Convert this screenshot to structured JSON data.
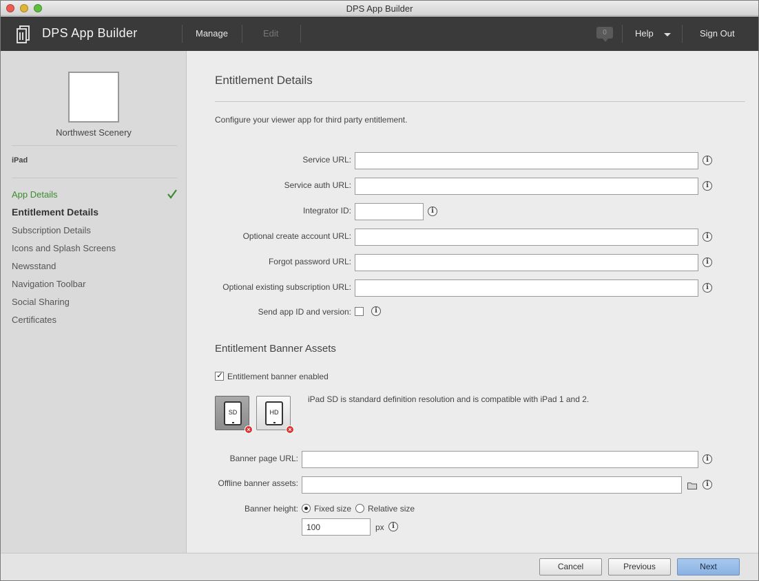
{
  "window": {
    "title": "DPS App Builder"
  },
  "header": {
    "app_name": "DPS App Builder",
    "nav": {
      "manage": "Manage",
      "edit": "Edit"
    },
    "notifications_count": "0",
    "help": "Help",
    "sign_out": "Sign Out"
  },
  "sidebar": {
    "publication_name": "Northwest Scenery",
    "device": "iPad",
    "items": [
      {
        "label": "App Details",
        "state": "done"
      },
      {
        "label": "Entitlement Details",
        "state": "active"
      },
      {
        "label": "Subscription Details",
        "state": ""
      },
      {
        "label": "Icons and Splash Screens",
        "state": ""
      },
      {
        "label": "Newsstand",
        "state": ""
      },
      {
        "label": "Navigation Toolbar",
        "state": ""
      },
      {
        "label": "Social Sharing",
        "state": ""
      },
      {
        "label": "Certificates",
        "state": ""
      }
    ]
  },
  "main": {
    "title": "Entitlement Details",
    "intro": "Configure your viewer app for third party entitlement.",
    "fields": {
      "service_url": {
        "label": "Service URL:",
        "value": ""
      },
      "service_auth_url": {
        "label": "Service auth URL:",
        "value": ""
      },
      "integrator_id": {
        "label": "Integrator ID:",
        "value": ""
      },
      "create_account_url": {
        "label": "Optional create account URL:",
        "value": ""
      },
      "forgot_password_url": {
        "label": "Forgot password URL:",
        "value": ""
      },
      "existing_subscription_url": {
        "label": "Optional existing subscription URL:",
        "value": ""
      },
      "send_app_id": {
        "label": "Send app ID and version:",
        "checked": false
      }
    },
    "banner": {
      "title": "Entitlement Banner Assets",
      "enabled_label": "Entitlement banner enabled",
      "enabled": true,
      "sd_label": "SD",
      "hd_label": "HD",
      "description": "iPad SD is standard definition resolution and is compatible with iPad 1 and 2.",
      "page_url_label": "Banner page URL:",
      "page_url_value": "",
      "offline_assets_label": "Offline banner assets:",
      "offline_assets_value": "",
      "height_label": "Banner height:",
      "fixed_label": "Fixed size",
      "relative_label": "Relative size",
      "selected_mode": "fixed",
      "height_value": "100",
      "unit": "px"
    },
    "info_glyph": "i"
  },
  "footer": {
    "cancel": "Cancel",
    "previous": "Previous",
    "next": "Next"
  },
  "colors": {
    "header_bg": "#3a3a3a",
    "sidebar_bg": "#dadada",
    "done_green": "#3c8b2e",
    "next_button": "#8ab2e2"
  },
  "icons": [
    "app-logo-icon",
    "notification-icon",
    "help-caret-icon",
    "checkmark-icon",
    "info-icon",
    "ipad-sd-icon",
    "ipad-hd-icon",
    "delete-icon",
    "folder-icon"
  ]
}
